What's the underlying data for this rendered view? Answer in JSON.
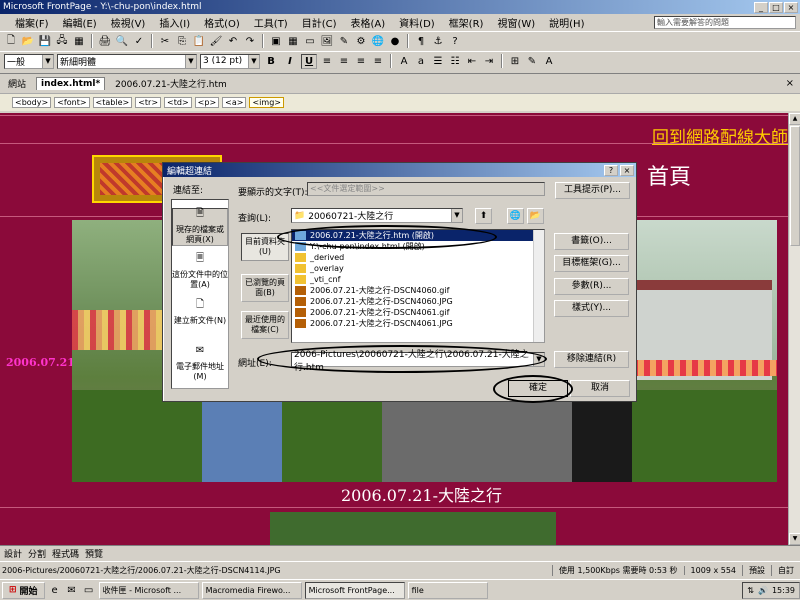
{
  "window": {
    "title": "Microsoft FrontPage - Y:\\-chu-pon\\index.html"
  },
  "menu": {
    "items": [
      "檔案(F)",
      "編輯(E)",
      "檢視(V)",
      "插入(I)",
      "格式(O)",
      "工具(T)",
      "目計(C)",
      "表格(A)",
      "資料(D)",
      "框架(R)",
      "視窗(W)",
      "說明(H)"
    ],
    "ask_placeholder": "輸入需要解答的問題"
  },
  "format_toolbar": {
    "style": "一般",
    "font": "新細明體",
    "size": "3 (12 pt)",
    "bold": "B",
    "italic": "I",
    "underline": "U"
  },
  "tabs": {
    "site": "網站",
    "active": "index.html*",
    "other": "2006.07.21-大陸之行.htm"
  },
  "tagbar": {
    "tags": [
      "<body>",
      "<font>",
      "<table>",
      "<tr>",
      "<td>",
      "<p>",
      "<a>",
      "<img>"
    ]
  },
  "page": {
    "back_link": "回到網路配線大師",
    "home_title": "首頁",
    "side_date": "2006.07.21",
    "caption": "2006.07.21-大陸之行"
  },
  "dialog": {
    "title": "編輯超連結",
    "link_to": "連結至:",
    "display_label": "要顯示的文字(T):",
    "display_value": "<<文件選定範圍>>",
    "screentip": "工具提示(P)...",
    "linkbar": [
      "現存的檔案或網頁(X)",
      "這份文件中的位置(A)",
      "建立新文件(N)",
      "電子郵件地址(M)"
    ],
    "look_in_label": "查詢(L):",
    "look_in_value": "20060721-大陸之行",
    "nav": [
      "目前資料夾(U)",
      "已瀏覽的頁面(B)",
      "最近使用的檔案(C)"
    ],
    "files": [
      "2006.07.21-大陸之行.htm (開啟)",
      "Y:\\-chu-pon\\index.html (開啟)",
      "_derived",
      "_overlay",
      "_vti_cnf",
      "2006.07.21-大陸之行-DSCN4060.gif",
      "2006.07.21-大陸之行-DSCN4060.JPG",
      "2006.07.21-大陸之行-DSCN4061.gif",
      "2006.07.21-大陸之行-DSCN4061.JPG"
    ],
    "right_buttons": [
      "書籤(O)...",
      "目標框架(G)...",
      "參數(R)...",
      "樣式(Y)...",
      "移除連結(R)"
    ],
    "address_label": "網址(E):",
    "address_value": "2006-Pictures\\20060721-大陸之行\\2006.07.21-大陸之行.htm",
    "ok": "確定",
    "cancel": "取消"
  },
  "viewbar": {
    "items": [
      "設計",
      "分割",
      "程式碼",
      "預覽"
    ]
  },
  "status": {
    "path": "2006-Pictures/20060721-大陸之行/2006.07.21-大陸之行-DSCN4114.JPG",
    "speed": "使用 1,500Kbps 需要時 0:53 秒",
    "dimensions": "1009 x 554",
    "mode": "預設",
    "custom": "自訂"
  },
  "taskbar": {
    "start": "開始",
    "tasks": [
      "收件匣 - Microsoft ...",
      "Macromedia Firewo...",
      "Microsoft FrontPage...",
      "file"
    ],
    "active_task": "Microsoft FrontPage...",
    "clock": "15:39"
  },
  "colors": {
    "page_bg": "#8b0a3a",
    "titlebar": "#0a246a",
    "accent_link": "#ffcc00",
    "side_date": "#ff33cc"
  }
}
